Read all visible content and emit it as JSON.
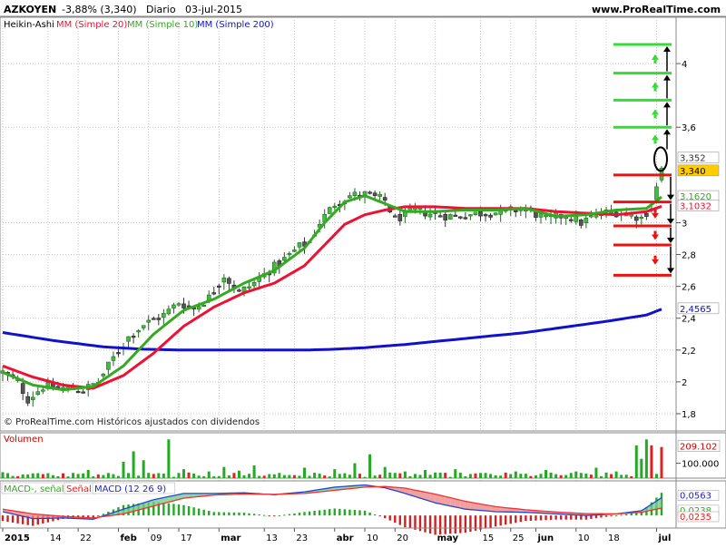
{
  "header": {
    "symbol": "AZKOYEN",
    "change": "-3,88% (3,340)",
    "period": "Diario",
    "date": "03-jul-2015",
    "site": "www.ProRealTime.com"
  },
  "legend": {
    "chart_type": "Heikin-Ashi",
    "ma20": "MM (Simple 20)",
    "ma10": "MM (Simple 10)",
    "ma200": "MM (Simple 200)"
  },
  "footer_note": "© ProRealTime.com Históricos ajustados con dividendos",
  "colors": {
    "ma20": "#ee1133",
    "ma10": "#33aa22",
    "ma200": "#1111cc",
    "bull": "#44bb44",
    "bear": "#555555",
    "grid": "#c8c8c8",
    "signal_green": "#33dd33",
    "signal_red": "#ee1111"
  },
  "chart_data": [
    {
      "type": "candlestick",
      "title": "AZKOYEN -3,88% (3,340) Diario 03-jul-2015",
      "ylim": [
        1.72,
        4.2
      ],
      "yticks": [
        {
          "label": "4",
          "value": 4.0
        },
        {
          "label": "3,6",
          "value": 3.6
        },
        {
          "label": "3",
          "value": 3.0
        },
        {
          "label": "2,8",
          "value": 2.8
        },
        {
          "label": "2,6",
          "value": 2.6
        },
        {
          "label": "2,4",
          "value": 2.4
        },
        {
          "label": "2,2",
          "value": 2.2
        },
        {
          "label": "2",
          "value": 2.0
        },
        {
          "label": "1,8",
          "value": 1.8
        }
      ],
      "xticks": [
        {
          "label": "2015",
          "day": 0
        },
        {
          "label": "14",
          "day": 9
        },
        {
          "label": "22",
          "day": 15
        },
        {
          "label": "feb",
          "day": 23
        },
        {
          "label": "09",
          "day": 29
        },
        {
          "label": "17",
          "day": 35
        },
        {
          "label": "mar",
          "day": 43
        },
        {
          "label": "13",
          "day": 52
        },
        {
          "label": "23",
          "day": 58
        },
        {
          "label": "abr",
          "day": 66
        },
        {
          "label": "10",
          "day": 72
        },
        {
          "label": "20",
          "day": 78
        },
        {
          "label": "may",
          "day": 86
        },
        {
          "label": "15",
          "day": 95
        },
        {
          "label": "25",
          "day": 101
        },
        {
          "label": "jun",
          "day": 106
        },
        {
          "label": "10",
          "day": 114
        },
        {
          "label": "18",
          "day": 120
        },
        {
          "label": "jul",
          "day": 130
        }
      ],
      "price_key": [
        [
          0,
          2.06
        ],
        [
          3,
          2.0
        ],
        [
          5,
          1.89
        ],
        [
          8,
          1.97
        ],
        [
          12,
          1.96
        ],
        [
          16,
          1.95
        ],
        [
          19,
          2.0
        ],
        [
          22,
          2.15
        ],
        [
          25,
          2.28
        ],
        [
          28,
          2.36
        ],
        [
          32,
          2.42
        ],
        [
          35,
          2.5
        ],
        [
          38,
          2.46
        ],
        [
          41,
          2.53
        ],
        [
          44,
          2.67
        ],
        [
          47,
          2.56
        ],
        [
          50,
          2.62
        ],
        [
          53,
          2.7
        ],
        [
          56,
          2.77
        ],
        [
          59,
          2.85
        ],
        [
          61,
          2.88
        ],
        [
          63,
          3.0
        ],
        [
          66,
          3.12
        ],
        [
          69,
          3.17
        ],
        [
          72,
          3.18
        ],
        [
          76,
          3.14
        ],
        [
          78,
          3.02
        ],
        [
          82,
          3.08
        ],
        [
          86,
          3.05
        ],
        [
          90,
          3.04
        ],
        [
          95,
          3.06
        ],
        [
          100,
          3.07
        ],
        [
          104,
          3.09
        ],
        [
          108,
          3.02
        ],
        [
          112,
          3.05
        ],
        [
          115,
          3.0
        ],
        [
          118,
          3.05
        ],
        [
          121,
          3.07
        ],
        [
          124,
          3.06
        ],
        [
          127,
          3.03
        ],
        [
          129,
          3.1
        ],
        [
          131,
          3.34
        ]
      ],
      "ma20_key": [
        [
          0,
          2.1
        ],
        [
          6,
          2.03
        ],
        [
          12,
          1.98
        ],
        [
          18,
          1.96
        ],
        [
          24,
          2.04
        ],
        [
          30,
          2.18
        ],
        [
          36,
          2.35
        ],
        [
          42,
          2.47
        ],
        [
          48,
          2.56
        ],
        [
          54,
          2.62
        ],
        [
          60,
          2.73
        ],
        [
          64,
          2.86
        ],
        [
          68,
          2.99
        ],
        [
          72,
          3.05
        ],
        [
          76,
          3.08
        ],
        [
          80,
          3.1
        ],
        [
          86,
          3.1
        ],
        [
          92,
          3.09
        ],
        [
          98,
          3.09
        ],
        [
          104,
          3.09
        ],
        [
          110,
          3.07
        ],
        [
          116,
          3.06
        ],
        [
          122,
          3.05
        ],
        [
          128,
          3.07
        ],
        [
          131,
          3.1032
        ]
      ],
      "ma10_key": [
        [
          0,
          2.06
        ],
        [
          6,
          1.98
        ],
        [
          12,
          1.95
        ],
        [
          18,
          1.97
        ],
        [
          24,
          2.1
        ],
        [
          30,
          2.3
        ],
        [
          36,
          2.45
        ],
        [
          42,
          2.52
        ],
        [
          48,
          2.62
        ],
        [
          54,
          2.7
        ],
        [
          60,
          2.84
        ],
        [
          64,
          3.0
        ],
        [
          68,
          3.13
        ],
        [
          72,
          3.17
        ],
        [
          76,
          3.12
        ],
        [
          80,
          3.07
        ],
        [
          86,
          3.07
        ],
        [
          92,
          3.08
        ],
        [
          98,
          3.08
        ],
        [
          104,
          3.09
        ],
        [
          110,
          3.04
        ],
        [
          116,
          3.05
        ],
        [
          122,
          3.08
        ],
        [
          128,
          3.09
        ],
        [
          131,
          3.162
        ]
      ],
      "ma200_key": [
        [
          0,
          2.31
        ],
        [
          10,
          2.26
        ],
        [
          20,
          2.22
        ],
        [
          28,
          2.205
        ],
        [
          36,
          2.2
        ],
        [
          44,
          2.2
        ],
        [
          52,
          2.2
        ],
        [
          60,
          2.2
        ],
        [
          66,
          2.205
        ],
        [
          72,
          2.215
        ],
        [
          80,
          2.235
        ],
        [
          88,
          2.26
        ],
        [
          96,
          2.285
        ],
        [
          104,
          2.31
        ],
        [
          112,
          2.345
        ],
        [
          120,
          2.38
        ],
        [
          128,
          2.42
        ],
        [
          131,
          2.4565
        ]
      ],
      "last_values": [
        {
          "label": "3,352",
          "value": 3.352,
          "color": "#ffffff",
          "text": "#333333"
        },
        {
          "label": "3,340",
          "value": 3.34,
          "color": "#ffcc00",
          "text": "#000000"
        },
        {
          "label": "3,1620",
          "value": 3.162,
          "color": "#ffffff",
          "text": "#33aa22"
        },
        {
          "label": "3,1032",
          "value": 3.1032,
          "color": "#ffffff",
          "text": "#ee1133"
        },
        {
          "label": "2,4565",
          "value": 2.4565,
          "color": "#ffffff",
          "text": "#1111cc"
        }
      ],
      "signal_levels": {
        "green": [
          4.12,
          3.94,
          3.77,
          3.6
        ],
        "red": [
          3.3,
          3.13,
          2.98,
          2.86,
          2.67
        ]
      }
    },
    {
      "type": "bar",
      "title": "Volumen",
      "ylim": [
        0,
        280000
      ],
      "yticks": [
        {
          "label": "100.000",
          "value": 100000
        }
      ],
      "last_label": "209.102",
      "last_value": 209102,
      "spikes": [
        [
          0,
          40000
        ],
        [
          5,
          25000
        ],
        [
          10,
          20000
        ],
        [
          14,
          35000
        ],
        [
          17,
          55000
        ],
        [
          24,
          110000
        ],
        [
          26,
          180000
        ],
        [
          28,
          120000
        ],
        [
          33,
          260000
        ],
        [
          36,
          60000
        ],
        [
          41,
          45000
        ],
        [
          44,
          75000
        ],
        [
          47,
          50000
        ],
        [
          50,
          85000
        ],
        [
          55,
          35000
        ],
        [
          60,
          70000
        ],
        [
          66,
          60000
        ],
        [
          70,
          100000
        ],
        [
          73,
          160000
        ],
        [
          76,
          75000
        ],
        [
          80,
          45000
        ],
        [
          84,
          55000
        ],
        [
          90,
          60000
        ],
        [
          96,
          35000
        ],
        [
          102,
          45000
        ],
        [
          108,
          55000
        ],
        [
          114,
          45000
        ],
        [
          118,
          70000
        ],
        [
          122,
          45000
        ],
        [
          126,
          220000
        ],
        [
          127,
          130000
        ],
        [
          128,
          260000
        ],
        [
          129,
          220000
        ],
        [
          131,
          209102
        ]
      ],
      "red_days": [
        3,
        8,
        12,
        19,
        30,
        37,
        46,
        52,
        58,
        64,
        71,
        75,
        79,
        88,
        94,
        100,
        105,
        111,
        117,
        121,
        125,
        129,
        131
      ]
    },
    {
      "type": "line",
      "title": "MACD (12 26 9)",
      "series_names": [
        "MACD-, señal",
        "Señal",
        "MACD (12 26 9)"
      ],
      "ylim": [
        -0.04,
        0.11
      ],
      "yticks": [
        {
          "label": "0,0563",
          "value": 0.0563
        },
        {
          "label": "0,0238",
          "value": 0.0238
        },
        {
          "label": "0,0235",
          "value": 0.0235
        }
      ],
      "macd_key": [
        [
          0,
          0.012
        ],
        [
          6,
          -0.01
        ],
        [
          12,
          -0.008
        ],
        [
          18,
          -0.012
        ],
        [
          24,
          0.02
        ],
        [
          30,
          0.05
        ],
        [
          36,
          0.07
        ],
        [
          42,
          0.07
        ],
        [
          48,
          0.072
        ],
        [
          54,
          0.066
        ],
        [
          60,
          0.075
        ],
        [
          66,
          0.09
        ],
        [
          72,
          0.097
        ],
        [
          76,
          0.088
        ],
        [
          80,
          0.07
        ],
        [
          86,
          0.04
        ],
        [
          92,
          0.02
        ],
        [
          98,
          0.012
        ],
        [
          104,
          0.01
        ],
        [
          110,
          0.005
        ],
        [
          116,
          0.0
        ],
        [
          122,
          0.005
        ],
        [
          127,
          0.015
        ],
        [
          131,
          0.0563
        ]
      ],
      "signal_key": [
        [
          0,
          0.02
        ],
        [
          6,
          0.005
        ],
        [
          12,
          -0.003
        ],
        [
          18,
          -0.008
        ],
        [
          24,
          0.005
        ],
        [
          30,
          0.03
        ],
        [
          36,
          0.055
        ],
        [
          42,
          0.065
        ],
        [
          48,
          0.068
        ],
        [
          54,
          0.067
        ],
        [
          60,
          0.07
        ],
        [
          66,
          0.08
        ],
        [
          72,
          0.09
        ],
        [
          76,
          0.092
        ],
        [
          80,
          0.087
        ],
        [
          86,
          0.068
        ],
        [
          92,
          0.045
        ],
        [
          98,
          0.028
        ],
        [
          104,
          0.018
        ],
        [
          110,
          0.011
        ],
        [
          116,
          0.006
        ],
        [
          122,
          0.005
        ],
        [
          127,
          0.01
        ],
        [
          131,
          0.0235
        ]
      ]
    }
  ]
}
